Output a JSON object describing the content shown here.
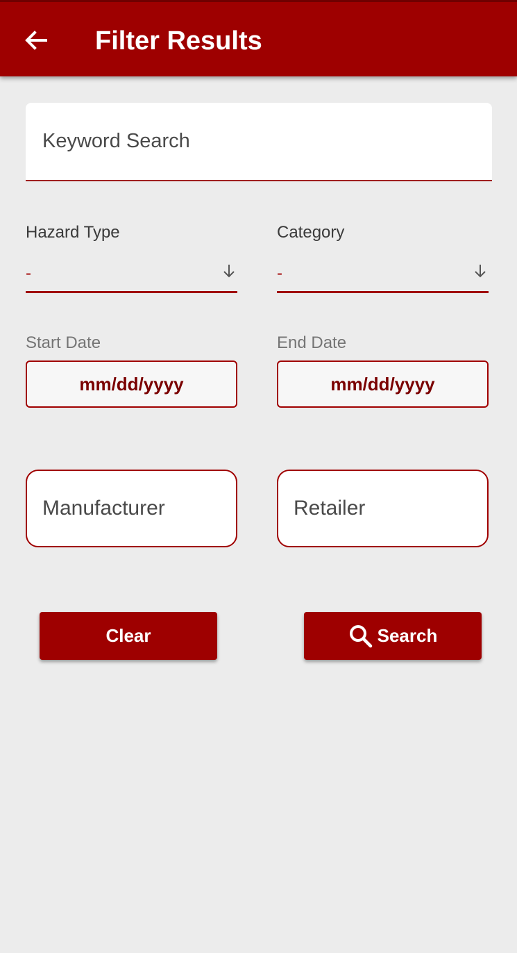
{
  "header": {
    "title": "Filter Results",
    "back_icon": "arrow-left-icon"
  },
  "keyword": {
    "placeholder": "Keyword Search"
  },
  "hazard_type": {
    "label": "Hazard Type",
    "value": "-",
    "icon": "arrow-down-icon"
  },
  "category": {
    "label": "Category",
    "value": "-",
    "icon": "arrow-down-icon"
  },
  "start_date": {
    "label": "Start Date",
    "value": "mm/dd/yyyy"
  },
  "end_date": {
    "label": "End Date",
    "value": "mm/dd/yyyy"
  },
  "manufacturer": {
    "placeholder": "Manufacturer"
  },
  "retailer": {
    "placeholder": "Retailer"
  },
  "buttons": {
    "clear_label": "Clear",
    "search_label": "Search",
    "search_icon": "search-icon"
  },
  "colors": {
    "primary": "#9e0000",
    "background": "#ececec",
    "date_text": "#7a0000"
  }
}
